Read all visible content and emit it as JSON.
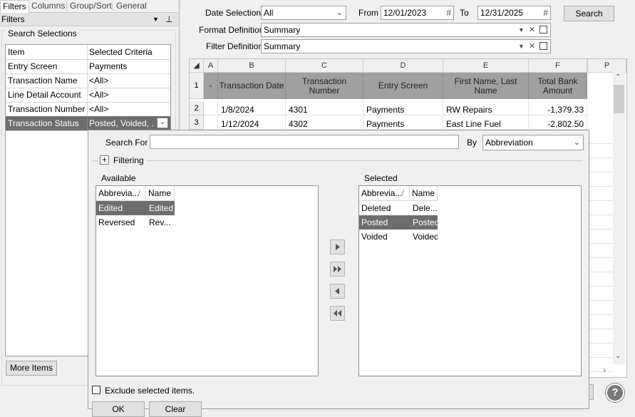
{
  "left_panel": {
    "tabs": [
      "Filters",
      "Columns",
      "Group/Sort",
      "General"
    ],
    "panel_title": "Filters",
    "search_selections_label": "Search Selections",
    "headers": [
      "Item",
      "Selected Criteria"
    ],
    "rows": [
      {
        "item": "Entry Screen",
        "criteria": "Payments"
      },
      {
        "item": "Transaction Name",
        "criteria": "<All>"
      },
      {
        "item": "Line Detail Account",
        "criteria": "<All>"
      },
      {
        "item": "Transaction Number",
        "criteria": "<All>"
      },
      {
        "item": "Transaction Status",
        "criteria": "Posted, Voided, ..."
      }
    ],
    "more_items_label": "More Items"
  },
  "criteria": {
    "date_selection_label": "Date Selection",
    "date_selection_value": "All",
    "from_label": "From",
    "from_value": "12/01/2023",
    "to_label": "To",
    "to_value": "12/31/2025",
    "search_button": "Search",
    "format_label": "Format Definition",
    "format_value": "Summary",
    "filter_label": "Filter Definition",
    "filter_value": "Summary"
  },
  "grid": {
    "col_letters": [
      "A",
      "B",
      "C",
      "D",
      "E",
      "F",
      "P"
    ],
    "row1_num": "1",
    "row1_dash": "-",
    "headers": [
      "Transaction Date",
      "Transaction Number",
      "Entry Screen",
      "First Name, Last Name",
      "Total Bank Amount"
    ],
    "rows": [
      {
        "num": "2",
        "date": "1/8/2024",
        "number": "4301",
        "screen": "Payments",
        "name": "RW Repairs",
        "amount": "-1,379.33"
      },
      {
        "num": "3",
        "date": "1/12/2024",
        "number": "4302",
        "screen": "Payments",
        "name": "East Line Fuel",
        "amount": "-2,802.50"
      }
    ]
  },
  "popup": {
    "search_for_label": "Search For",
    "search_for_value": "",
    "by_label": "By",
    "by_value": "Abbreviation",
    "filtering_label": "Filtering",
    "available_label": "Available",
    "selected_label": "Selected",
    "col_abbrev": "Abbrevia...",
    "col_name": "Name",
    "available_items": [
      {
        "abbrev": "Edited",
        "name": "Edited",
        "selected": true
      },
      {
        "abbrev": "Reversed",
        "name": "Rev...",
        "selected": false
      }
    ],
    "selected_items": [
      {
        "abbrev": "Deleted",
        "name": "Dele...",
        "selected": false
      },
      {
        "abbrev": "Posted",
        "name": "Posted",
        "selected": true
      },
      {
        "abbrev": "Voided",
        "name": "Voided",
        "selected": false
      }
    ],
    "exclude_label": "Exclude selected items.",
    "ok_label": "OK",
    "clear_label": "Clear"
  }
}
